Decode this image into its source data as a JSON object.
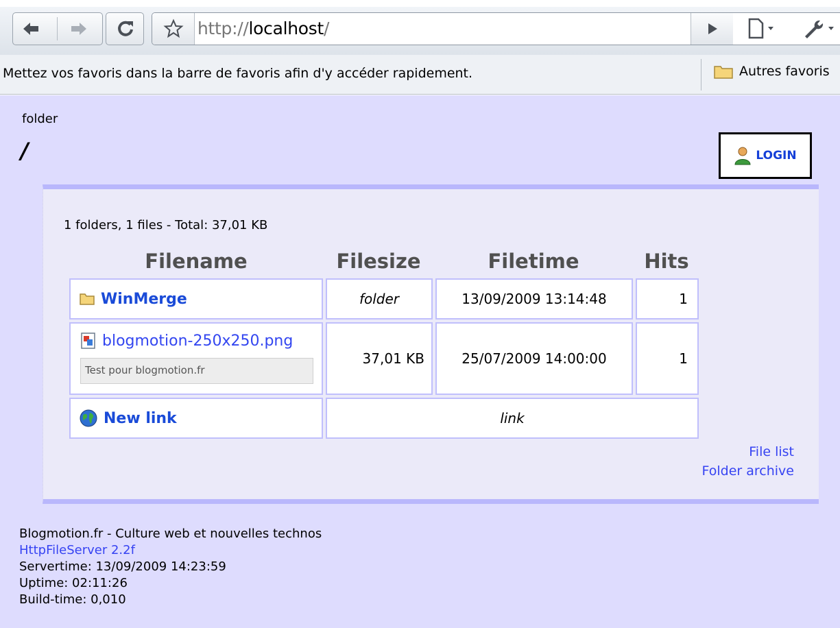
{
  "browser": {
    "url_prefix": "http://",
    "url_host": "localhost",
    "url_suffix": "/",
    "bookmarks_hint": "Mettez vos favoris dans la barre de favoris afin d'y accéder rapidement.",
    "other_bookmarks": "Autres favoris"
  },
  "page": {
    "folder_label": "folder",
    "folder_path": "/",
    "login_label": "LOGIN",
    "summary": "1 folders, 1 files - Total: 37,01 KB",
    "columns": {
      "filename": "Filename",
      "filesize": "Filesize",
      "filetime": "Filetime",
      "hits": "Hits"
    },
    "rows": [
      {
        "name": "WinMerge",
        "size": "folder",
        "time": "13/09/2009 13:14:48",
        "hits": "1",
        "kind": "folder"
      },
      {
        "name": "blogmotion-250x250.png",
        "comment": "Test pour blogmotion.fr",
        "size": "37,01 KB",
        "time": "25/07/2009 14:00:00",
        "hits": "1",
        "kind": "file"
      },
      {
        "name": "New link",
        "size": "link",
        "kind": "link"
      }
    ],
    "links": {
      "file_list": "File list",
      "folder_archive": "Folder archive"
    }
  },
  "footer": {
    "tagline": "Blogmotion.fr - Culture web et nouvelles technos",
    "server_name": "HttpFileServer 2.2f",
    "servertime": "Servertime: 13/09/2009 14:23:59",
    "uptime": "Uptime: 02:11:26",
    "buildtime": "Build-time: 0,010"
  },
  "colors": {
    "page_bg": "#dedcfe",
    "accent_link": "#1a4bd8",
    "panel_border": "#b9b7fc"
  }
}
